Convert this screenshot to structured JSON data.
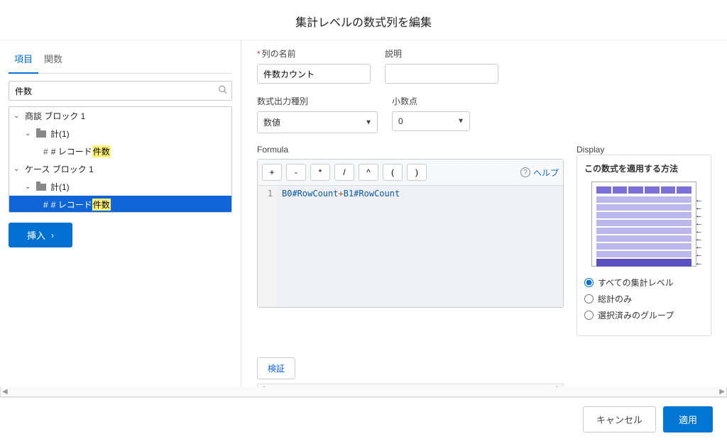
{
  "header": {
    "title": "集計レベルの数式列を編集"
  },
  "left": {
    "tabs": {
      "fields": "項目",
      "functions": "関数"
    },
    "search": {
      "value": "件数"
    },
    "tree": {
      "block1": {
        "label": "商談 ブロック 1"
      },
      "block1_sub": {
        "label_prefix": "計 ",
        "count": "(1)"
      },
      "block1_leaf": {
        "prefix": "# レコード",
        "match": "件数"
      },
      "block2": {
        "label": "ケース ブロック 1"
      },
      "block2_sub": {
        "label_prefix": "計 ",
        "count": "(1)"
      },
      "block2_leaf": {
        "prefix": "# レコード",
        "match": "件数"
      }
    },
    "insert_btn": "挿入"
  },
  "form": {
    "name_label": "列の名前",
    "name_value": "件数カウント",
    "desc_label": "説明",
    "desc_value": "",
    "output_label": "数式出力種別",
    "output_value": "数値",
    "decimal_label": "小数点",
    "decimal_value": "0"
  },
  "editor": {
    "title": "Formula",
    "ops": [
      "+",
      "-",
      "*",
      "/",
      "^",
      "(",
      ")"
    ],
    "help": "ヘルプ",
    "line_no": "1",
    "code": {
      "a": "B0",
      "b": "#RowCount",
      "op": "+",
      "c": "B1",
      "d": "#RowCount"
    }
  },
  "display": {
    "title": "Display",
    "subtitle": "この数式を適用する方法",
    "opt1": "すべての集計レベル",
    "opt2": "総計のみ",
    "opt3": "選択済みのグループ"
  },
  "validate": "検証",
  "footer": {
    "cancel": "キャンセル",
    "apply": "適用"
  }
}
